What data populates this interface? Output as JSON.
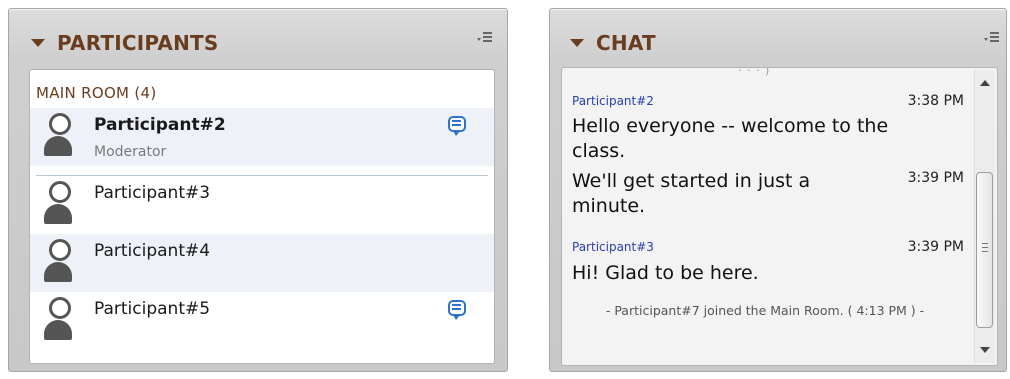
{
  "participants_panel": {
    "title": "PARTICIPANTS",
    "room_heading": "MAIN ROOM (4)",
    "participants": [
      {
        "name": "Participant#2",
        "role": "Moderator",
        "chat_icon": true
      },
      {
        "name": "Participant#3",
        "role": "",
        "chat_icon": false
      },
      {
        "name": "Participant#4",
        "role": "",
        "chat_icon": false
      },
      {
        "name": "Participant#5",
        "role": "",
        "chat_icon": true
      }
    ]
  },
  "chat_panel": {
    "title": "CHAT",
    "truncated_top": "· · · )",
    "messages": [
      {
        "sender": "Participant#2",
        "time": "3:38 PM",
        "text": "Hello everyone -- welcome to the class."
      },
      {
        "sender": "",
        "time": "3:39 PM",
        "text": "We'll get started in just a minute."
      },
      {
        "sender": "Participant#3",
        "time": "3:39 PM",
        "text": "Hi! Glad to be here."
      }
    ],
    "system_message": "- Participant#7 joined the Main Room. ( 4:13 PM ) -"
  },
  "icons": {
    "collapse": "triangle-down-icon",
    "panel_menu": "panel-menu-icon",
    "avatar": "user-avatar-icon",
    "chat": "chat-bubble-icon"
  },
  "colors": {
    "title": "#6a3d1f",
    "chat_icon": "#2f73c9",
    "sender": "#2a3eb0",
    "row_highlight": "#eef2f8"
  }
}
